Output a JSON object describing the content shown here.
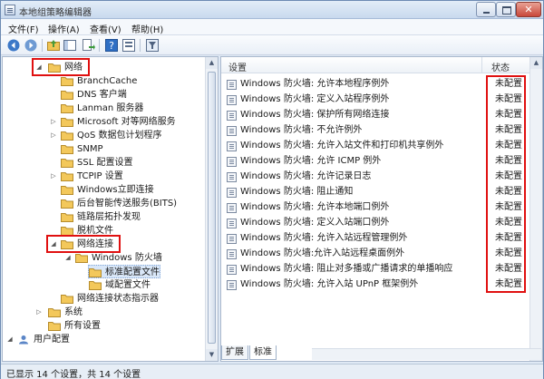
{
  "window": {
    "title": "本地组策略编辑器",
    "close_glyph": "✕"
  },
  "menu": [
    {
      "label": "文件(F)"
    },
    {
      "label": "操作(A)"
    },
    {
      "label": "查看(V)"
    },
    {
      "label": "帮助(H)"
    }
  ],
  "toolbar": {
    "icons": [
      "back-icon",
      "forward-icon",
      "up-folder-icon",
      "show-hide-tree-icon",
      "export-list-icon",
      "help-icon",
      "properties-icon",
      "filter-icon"
    ]
  },
  "tree": {
    "items": [
      {
        "label": "网络",
        "toggle": "◢",
        "expanded": true
      },
      {
        "label": "BranchCache"
      },
      {
        "label": "DNS 客户端"
      },
      {
        "label": "Lanman 服务器"
      },
      {
        "label": "Microsoft 对等网络服务",
        "toggle": "▷"
      },
      {
        "label": "QoS 数据包计划程序",
        "toggle": "▷"
      },
      {
        "label": "SNMP"
      },
      {
        "label": "SSL 配置设置"
      },
      {
        "label": "TCPIP 设置",
        "toggle": "▷"
      },
      {
        "label": "Windows立即连接"
      },
      {
        "label": "后台智能传送服务(BITS)"
      },
      {
        "label": "链路层拓扑发现"
      },
      {
        "label": "脱机文件"
      },
      {
        "label": "网络连接",
        "toggle": "◢",
        "expanded": true
      },
      {
        "label": "Windows 防火墙",
        "toggle": "◢",
        "expanded": true
      },
      {
        "label": "标准配置文件",
        "selected": true
      },
      {
        "label": "域配置文件"
      },
      {
        "label": "网络连接状态指示器"
      },
      {
        "label": "系统",
        "toggle": "▷"
      },
      {
        "label": "所有设置"
      },
      {
        "label": "用户配置",
        "toggle": "◢"
      }
    ]
  },
  "list": {
    "col_setting": "设置",
    "col_status": "状态",
    "rows": [
      {
        "name": "Windows 防火墙: 允许本地程序例外",
        "status": "未配置"
      },
      {
        "name": "Windows 防火墙: 定义入站程序例外",
        "status": "未配置"
      },
      {
        "name": "Windows 防火墙: 保护所有网络连接",
        "status": "未配置"
      },
      {
        "name": "Windows 防火墙: 不允许例外",
        "status": "未配置"
      },
      {
        "name": "Windows 防火墙: 允许入站文件和打印机共享例外",
        "status": "未配置"
      },
      {
        "name": "Windows 防火墙: 允许 ICMP 例外",
        "status": "未配置"
      },
      {
        "name": "Windows 防火墙: 允许记录日志",
        "status": "未配置"
      },
      {
        "name": "Windows 防火墙: 阻止通知",
        "status": "未配置"
      },
      {
        "name": "Windows 防火墙: 允许本地端口例外",
        "status": "未配置"
      },
      {
        "name": "Windows 防火墙: 定义入站端口例外",
        "status": "未配置"
      },
      {
        "name": "Windows 防火墙: 允许入站远程管理例外",
        "status": "未配置"
      },
      {
        "name": "Windows 防火墙:允许入站远程桌面例外",
        "status": "未配置"
      },
      {
        "name": "Windows 防火墙: 阻止对多播或广播请求的单播响应",
        "status": "未配置"
      },
      {
        "name": "Windows 防火墙: 允许入站 UPnP 框架例外",
        "status": "未配置"
      }
    ]
  },
  "tabs": [
    {
      "label": "扩展"
    },
    {
      "label": "标准"
    }
  ],
  "scroll_glyphs": {
    "up": "▲",
    "down": "▼"
  },
  "status_bar": {
    "text": "已显示 14 个设置，共 14 个设置"
  },
  "colors": {
    "highlight_box": "#e01010",
    "selection": "#d9e7f8"
  }
}
